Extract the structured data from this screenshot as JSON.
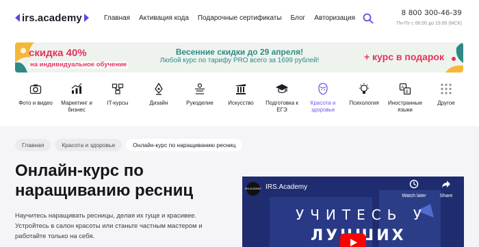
{
  "header": {
    "logo": "irs.academy",
    "nav": [
      "Главная",
      "Активация кода",
      "Подарочные сертификаты",
      "Блог",
      "Авторизация"
    ],
    "phone": "8 800 300-46-39",
    "hours": "Пн-Пт с 06:00 до 15:00 (МСК)"
  },
  "banner": {
    "discount": "скидка 40%",
    "discount_sub": "на индивидуальное обучение",
    "headline": "Весенние скидки до 29 апреля!",
    "subline": "Любой курс по тарифу PRO всего за 1699 рублей!",
    "gift": "+ курс в подарок"
  },
  "categories": [
    {
      "label": "Фото и видео",
      "icon": "camera-icon"
    },
    {
      "label": "Маркетинг и бизнес",
      "icon": "chart-icon"
    },
    {
      "label": "IT-курсы",
      "icon": "network-icon"
    },
    {
      "label": "Дизайн",
      "icon": "pen-tool-icon"
    },
    {
      "label": "Рукоделие",
      "icon": "craft-icon"
    },
    {
      "label": "Искусство",
      "icon": "column-icon"
    },
    {
      "label": "Подготовка к ЕГЭ",
      "icon": "graduation-cap-icon"
    },
    {
      "label": "Красота и здоровье",
      "icon": "face-icon",
      "active": true
    },
    {
      "label": "Психология",
      "icon": "lightbulb-icon"
    },
    {
      "label": "Иностранные языки",
      "icon": "translate-icon"
    },
    {
      "label": "Другое",
      "icon": "grid-dots-icon"
    }
  ],
  "breadcrumbs": [
    "Главная",
    "Красота и здоровье",
    "Онлайн-курс по наращиванию ресниц"
  ],
  "page": {
    "title": "Онлайн-курс по наращиванию ресниц",
    "description": "Научитесь наращивать ресницы, делая их гуще и красивее. Устройтесь в салон красоты или станьте частным мастером и работайте только на себя."
  },
  "video": {
    "avatar_text": "IRS.ACADEMY",
    "channel": "IRS.Academy",
    "watch_later": "Watch later",
    "share": "Share",
    "overlay_line1": "УЧИТЕСЬ У",
    "overlay_line2": "ЛУЧШИХ"
  },
  "colors": {
    "accent": "#5a48e4",
    "promo_red": "#e8325a",
    "promo_teal": "#2e8a86",
    "active_category": "#6a5ae8"
  }
}
